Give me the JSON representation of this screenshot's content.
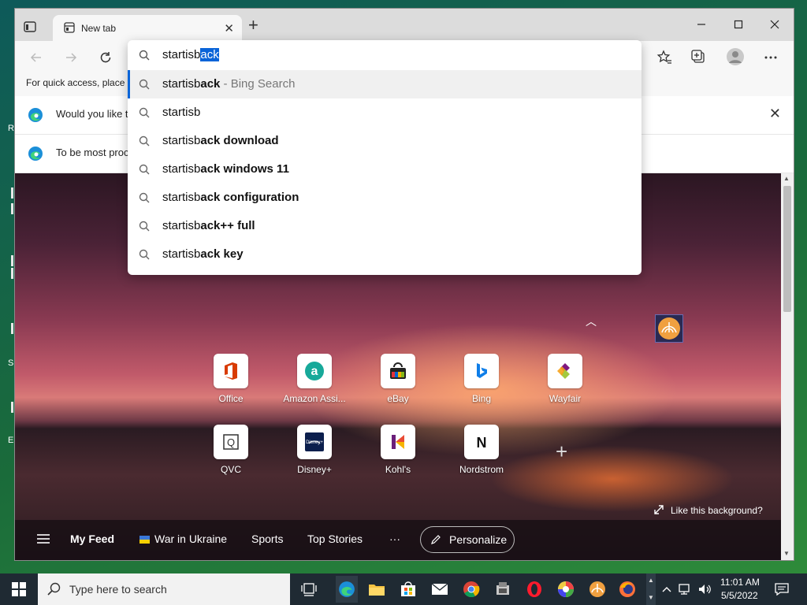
{
  "browser": {
    "tab": {
      "title": "New tab"
    },
    "favorites_hint": "For quick access, place y",
    "infobars": [
      {
        "text": "Would you like t"
      },
      {
        "text": "To be most proc"
      }
    ]
  },
  "omnibox": {
    "query_typed": "startisb",
    "query_autocomplete": "ack",
    "suggestions": [
      {
        "prefix": "startisb",
        "completion": "ack",
        "source": " - Bing Search",
        "active": true
      },
      {
        "prefix": "startisb",
        "completion": "",
        "source": ""
      },
      {
        "prefix": "startisb",
        "completion": "ack download",
        "source": ""
      },
      {
        "prefix": "startisb",
        "completion": "ack windows 11",
        "source": ""
      },
      {
        "prefix": "startisb",
        "completion": "ack configuration",
        "source": ""
      },
      {
        "prefix": "startisb",
        "completion": "ack++ full",
        "source": ""
      },
      {
        "prefix": "startisb",
        "completion": "ack key",
        "source": ""
      }
    ]
  },
  "quick_links": [
    {
      "label": "Office",
      "icon": "office-icon"
    },
    {
      "label": "Amazon Assi...",
      "icon": "amazon-assistant-icon"
    },
    {
      "label": "eBay",
      "icon": "ebay-icon"
    },
    {
      "label": "Bing",
      "icon": "bing-icon"
    },
    {
      "label": "Wayfair",
      "icon": "wayfair-icon"
    },
    {
      "label": "QVC",
      "icon": "qvc-icon"
    },
    {
      "label": "Disney+",
      "icon": "disney-plus-icon"
    },
    {
      "label": "Kohl's",
      "icon": "kohls-icon"
    },
    {
      "label": "Nordstrom",
      "icon": "nordstrom-icon"
    }
  ],
  "ntp": {
    "like_background": "Like this background?",
    "feed": {
      "my_feed": "My Feed",
      "war": "War in Ukraine",
      "sports": "Sports",
      "top_stories": "Top Stories",
      "more": "···",
      "personalize": "Personalize"
    }
  },
  "taskbar": {
    "search_placeholder": "Type here to search",
    "time": "11:01 AM",
    "date": "5/5/2022"
  },
  "desktop": {
    "label_r": "R",
    "label_s": "S",
    "label_e": "E"
  }
}
